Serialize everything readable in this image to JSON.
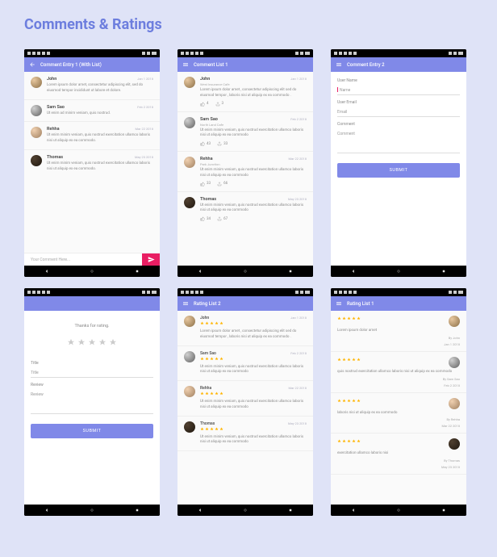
{
  "page_title": "Comments & Ratings",
  "colors": {
    "accent": "#8089e8",
    "pink": "#e91e63",
    "star": "#ffb400"
  },
  "screens": {
    "s1": {
      "title": "Comment Entry 1 (With List)",
      "comments": [
        {
          "name": "John",
          "date": "Jan 1 2018",
          "text": "Lorem ipsum dolor amet, consectetur adipiscing elit, sed do eiusmod tempor incididunt ut labore et dolore."
        },
        {
          "name": "Sam Sao",
          "date": "Feb 2 2018",
          "text": "Ut enim ad minim veniam, quis nostrud."
        },
        {
          "name": "Rehha",
          "date": "Mar 22 2018",
          "text": "Ut enim minim veniam, quis nostrud exercitation ullamco laboris nisi ut aliquip ex ea commodo."
        },
        {
          "name": "Thomas",
          "date": "May 23 2018",
          "text": "Ut enim minim veniam, quis nostrud exercitation ullamco laboris nisi ut aliquip ex ea commodo."
        }
      ],
      "input_placeholder": "Your Comment Here..."
    },
    "s2": {
      "title": "Comment List 1",
      "comments": [
        {
          "name": "John",
          "sub": "West Insurance Cafe",
          "date": "Jan 1 2018",
          "text": "Lorem ipsum dolor amet , consectetur adipiscing elit sed do eiusmod tempor , laboris nisi ut aliquip ex ea commodo .",
          "likes": 4,
          "shares": 3
        },
        {
          "name": "Sam Sao",
          "sub": "North Land Cafe",
          "date": "Feb 2 2018",
          "text": "Ut enim minim veniam, quis nostrud exercitation ullamco laboris nisi ut aliquip ex ea commodo",
          "likes": 43,
          "shares": 33
        },
        {
          "name": "Rehha",
          "sub": "Park Junction",
          "date": "Mar 22 2018",
          "text": "Ut enim minim veniam, quis nostrud exercitation ullamco laboris nisi ut aliquip ex ea commodo",
          "likes": 33,
          "shares": 66
        },
        {
          "name": "Thomas",
          "sub": "",
          "date": "May 23 2018",
          "text": "Ut enim minim veniam, quis nostrud exercitation ullamco laboris nisi ut aliquip ex ea commodo",
          "likes": 34,
          "shares": 67
        }
      ]
    },
    "s3": {
      "title": "Comment Entry 2",
      "labels": {
        "name": "User Name",
        "email": "User Email",
        "comment": "Comment"
      },
      "placeholders": {
        "name": "Name",
        "email": "Email",
        "comment": "Comment"
      },
      "submit": "SUBMIT"
    },
    "s4": {
      "thanks": "Thanks for rating.",
      "labels": {
        "title": "Title",
        "review": "Review"
      },
      "placeholders": {
        "title": "Title",
        "review": "Review"
      },
      "submit": "SUBMIT"
    },
    "s5": {
      "title": "Rating List 2",
      "items": [
        {
          "name": "John",
          "date": "Jan 1 2018",
          "stars": 5,
          "text": "Lorem ipsum dolor amet , consectetur adipiscing elit sed do eiusmod tempor , laboris nisi ut aliquip ex ea commodo ."
        },
        {
          "name": "Sam Sao",
          "date": "Feb 2 2018",
          "stars": 5,
          "text": "Ut enim minim veniam, quis nostrud exercitation ullamco laboris nisi ut aliquip ex ea commodo"
        },
        {
          "name": "Rehha",
          "date": "Mar 22 2018",
          "stars": 5,
          "text": "Ut enim minim veniam, quis nostrud exercitation ullamco laboris nisi ut aliquip ex ea commodo"
        },
        {
          "name": "Thomas",
          "date": "May 23 2018",
          "stars": 5,
          "text": "Ut enim minim veniam, quis nostrud exercitation ullamco laboris nisi ut aliquip ex ea commodo"
        }
      ]
    },
    "s6": {
      "title": "Rating List 1",
      "items": [
        {
          "stars": 5,
          "text": "Lorem ipsum dolor amet",
          "by": "By John",
          "date": "Jan 1 2018"
        },
        {
          "stars": 5,
          "text": "quis nostrud exercitation ullamco laboris nisi ut aliquip ex ea commodo",
          "by": "By Sam Sao",
          "date": "Feb 2 2018"
        },
        {
          "stars": 5,
          "text": "laboris nisi ut aliquip ex ea commodo",
          "by": "By Rehha",
          "date": "Mar 22 2018"
        },
        {
          "stars": 5,
          "text": "exercitation ullamco laboris nisi",
          "by": "By Thomas",
          "date": "May 23 2018"
        }
      ]
    }
  }
}
